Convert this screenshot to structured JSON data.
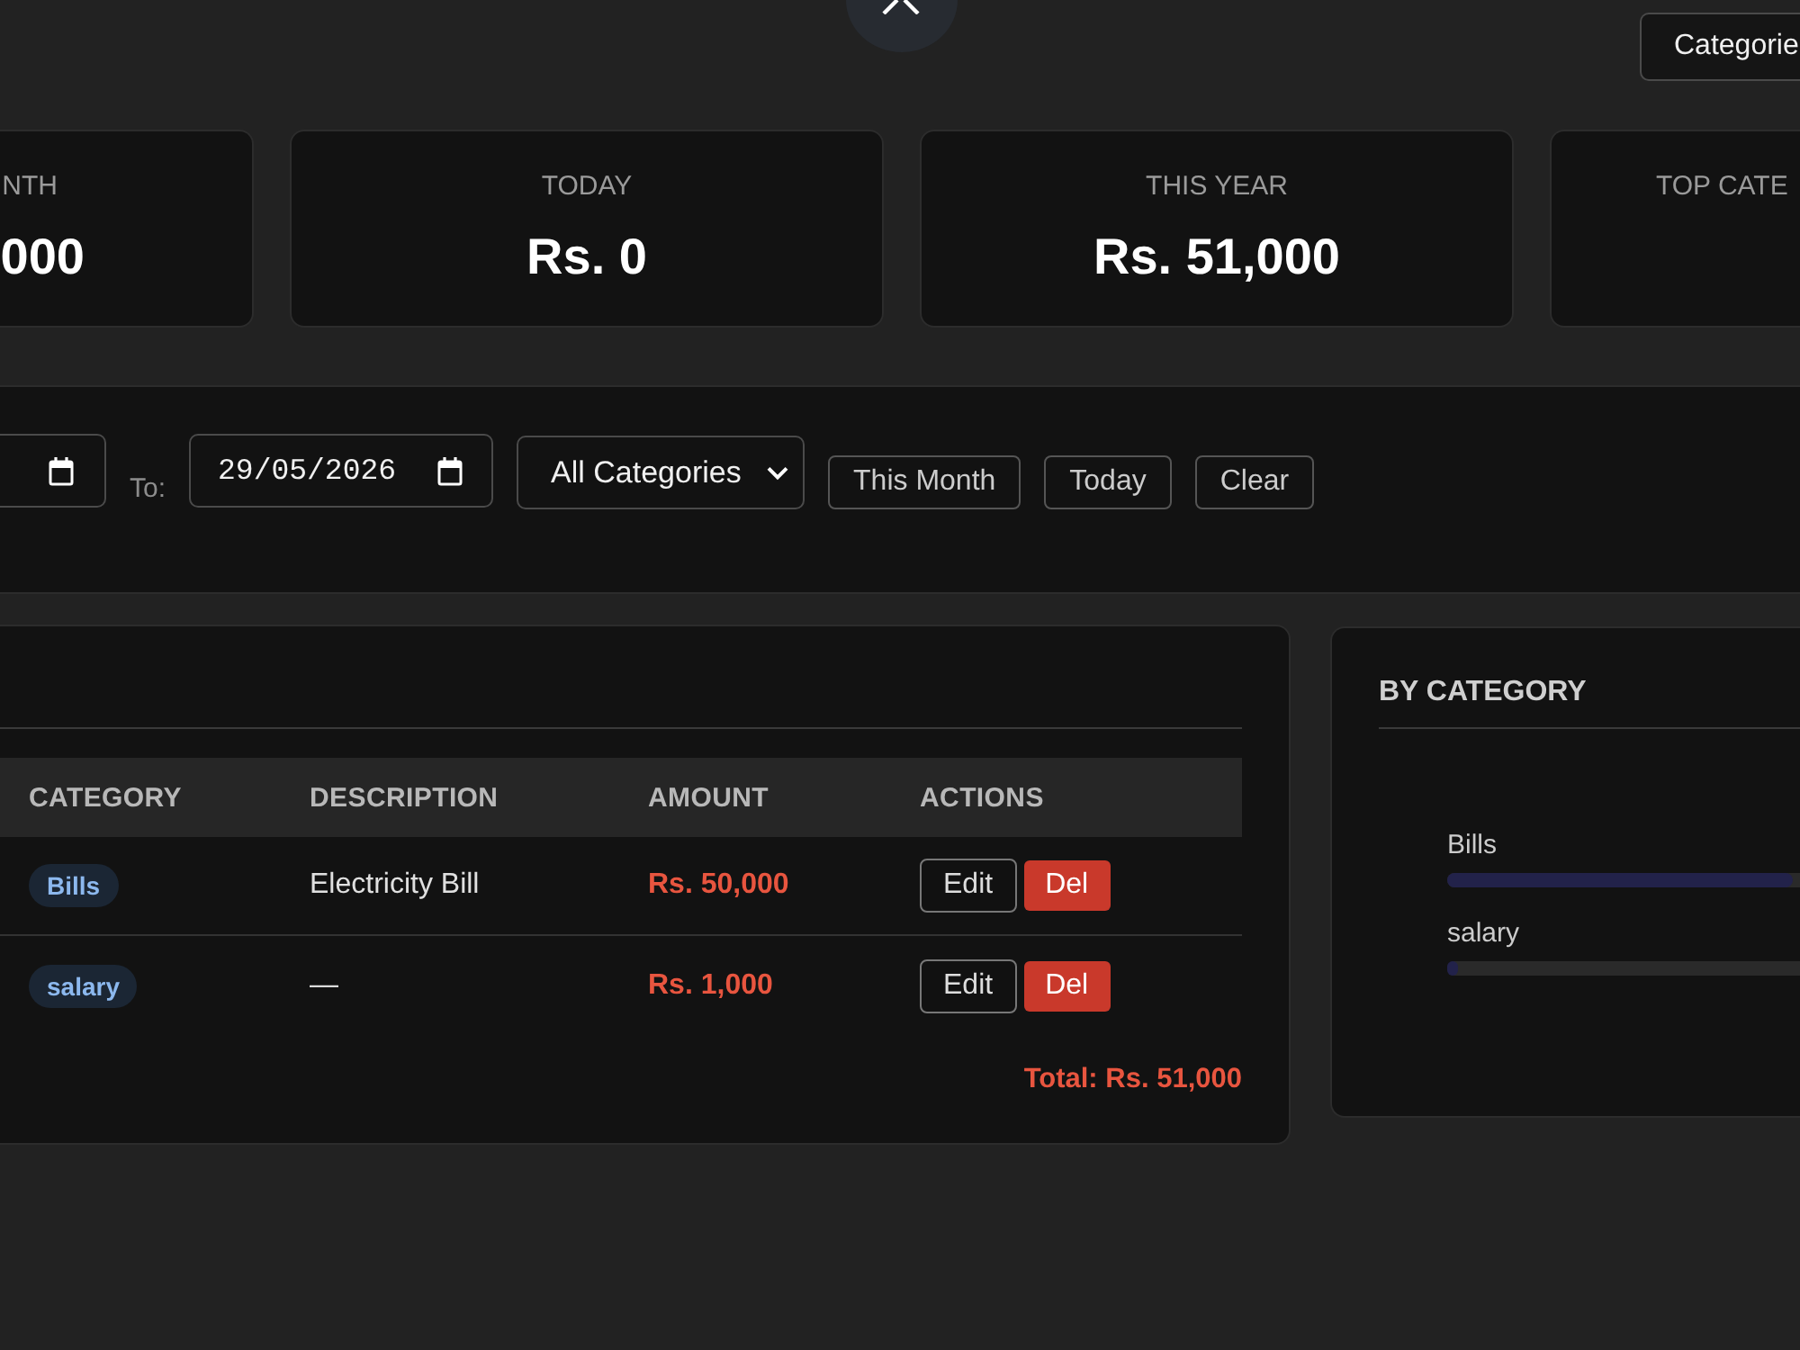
{
  "header": {
    "categories_button": "Categorie"
  },
  "stats": [
    {
      "label": "NTH",
      "value": "000"
    },
    {
      "label": "TODAY",
      "value": "Rs. 0"
    },
    {
      "label": "THIS YEAR",
      "value": "Rs. 51,000"
    },
    {
      "label": "TOP CATE"
    }
  ],
  "filters": {
    "to_label": "To:",
    "to_date": "29/05/2026",
    "category_select": "All Categories",
    "buttons": [
      "This Month",
      "Today",
      "Clear"
    ]
  },
  "transactions": {
    "columns": [
      "CATEGORY",
      "DESCRIPTION",
      "AMOUNT",
      "ACTIONS"
    ],
    "rows": [
      {
        "category": "Bills",
        "description": "Electricity Bill",
        "amount": "Rs. 50,000",
        "actions": [
          {
            "label": "Edit",
            "kind": "edit"
          },
          {
            "label": "Del",
            "kind": "delete"
          }
        ]
      },
      {
        "category": "salary",
        "description": "—",
        "amount": "Rs. 1,000",
        "actions": [
          {
            "label": "Edit",
            "kind": "edit"
          },
          {
            "label": "Del",
            "kind": "delete"
          }
        ]
      }
    ],
    "total": "Total: Rs. 51,000"
  },
  "by_category": {
    "title": "BY CATEGORY",
    "items": [
      {
        "name": "Bills",
        "level": 0.98
      },
      {
        "name": "salary",
        "level": 0.02
      }
    ]
  }
}
